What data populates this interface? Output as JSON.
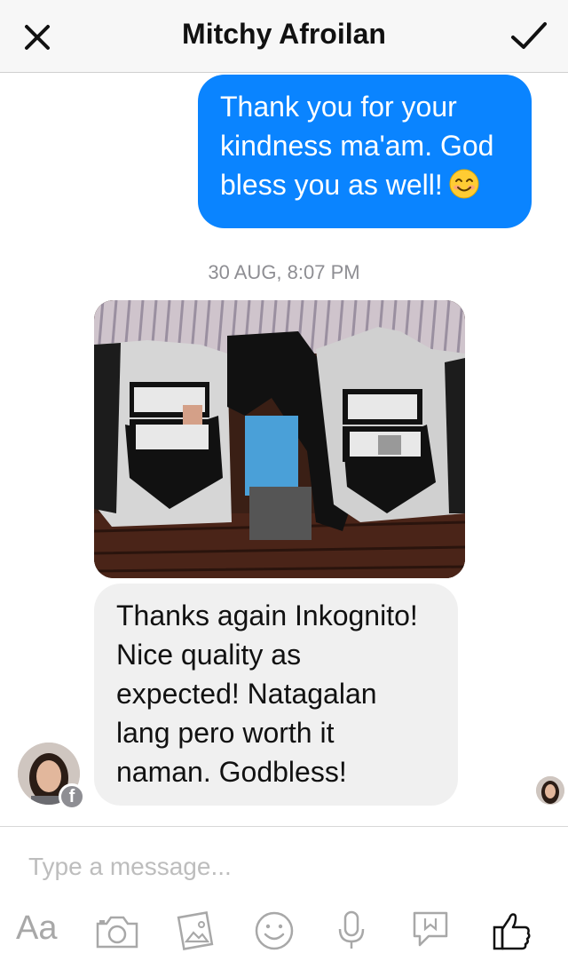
{
  "header": {
    "title": "Mitchy Afroilan",
    "close_icon": "close-icon",
    "done_icon": "checkmark-icon"
  },
  "messages": {
    "outgoing": {
      "lines": [
        "Thank you for your",
        "kindness ma'am. God",
        "bless you as well!"
      ],
      "emoji": "smiling-face-emoji",
      "color": "#0a84ff"
    },
    "timestamp": "30 AUG, 8:07 PM",
    "photo": {
      "description_icon": "photo-attachment"
    },
    "incoming": {
      "lines": [
        "Thanks again Inkognito!",
        "Nice quality as",
        "expected! Natagalan",
        "lang pero worth it",
        "naman. Godbless!"
      ],
      "color": "#f0f0f0"
    }
  },
  "composer": {
    "placeholder": "Type a message...",
    "toolbar": [
      "text-format-icon",
      "camera-icon",
      "gallery-icon",
      "emoji-icon",
      "microphone-icon",
      "sticker-icon",
      "thumbs-up-icon"
    ],
    "aa_label": "Aa"
  }
}
